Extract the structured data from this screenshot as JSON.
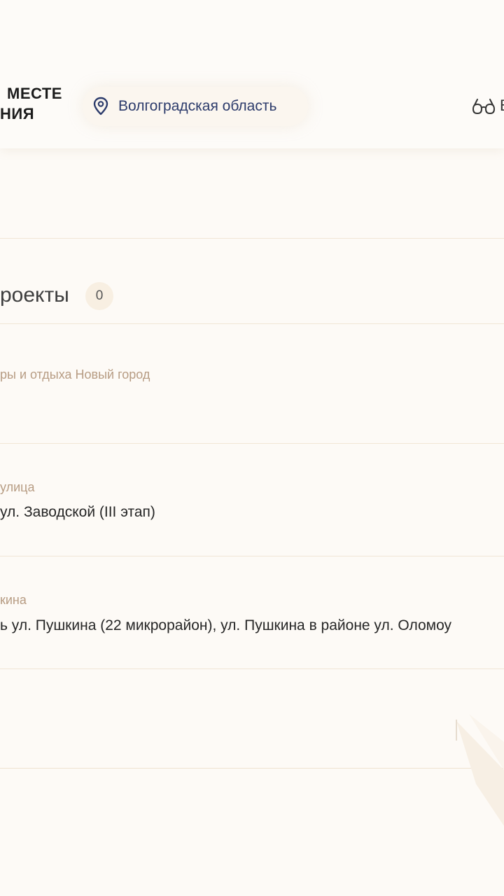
{
  "header": {
    "logo_line_1": "МЕСТЕ",
    "logo_line_2": "НИЯ",
    "region": "Волгоградская область",
    "accessibility_label": "В"
  },
  "projects": {
    "title": "роекты",
    "count": "0",
    "items": [
      {
        "category": "ры и отдыха Новый город",
        "name": ""
      },
      {
        "category": "улица",
        "name": "ул. Заводской (III этап)"
      },
      {
        "category": "кина",
        "name": "ь ул. Пушкина (22 микрорайон), ул. Пушкина в районе ул. Оломоу"
      }
    ]
  },
  "colors": {
    "accent_blue": "#2c3b6b",
    "category_tan": "#b79c83",
    "background": "#fdfaf6"
  },
  "icons": {
    "pin": "map-pin-icon",
    "glasses": "glasses-icon"
  }
}
